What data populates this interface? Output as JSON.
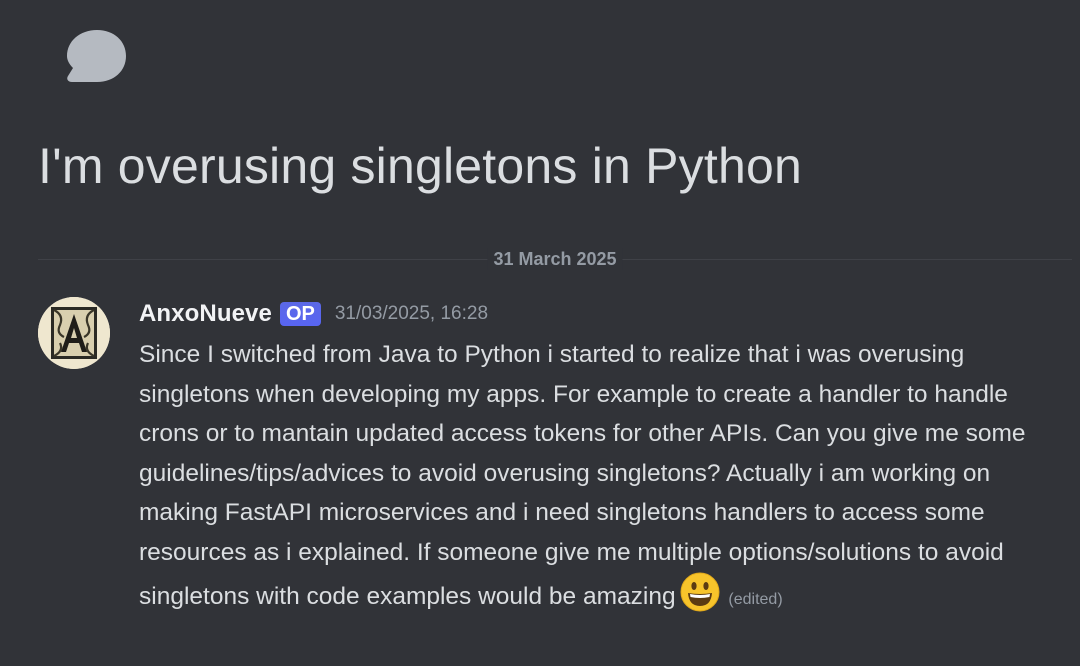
{
  "thread": {
    "title": "I'm overusing singletons in Python",
    "icon": "speech-bubble-icon"
  },
  "divider": {
    "date": "31 March 2025"
  },
  "message": {
    "author": "AnxoNueve",
    "badge": "OP",
    "timestamp": "31/03/2025, 16:28",
    "body": "Since I switched from Java to Python i started to realize that i was overusing singletons when developing my apps. For example to create a handler to handle crons or to mantain updated access tokens for other APIs. Can you give me some guidelines/tips/advices to avoid overusing singletons? Actually i am working on making FastAPI microservices and i need singletons handlers to access some resources as i explained. If someone give me multiple options/solutions to avoid singletons with code examples would be amazing",
    "emoji": "grinning-face-emoji",
    "edited": "(edited)"
  },
  "colors": {
    "background": "#313338",
    "text": "#dbdee1",
    "muted": "#949ba4",
    "badge": "#5865f2"
  }
}
